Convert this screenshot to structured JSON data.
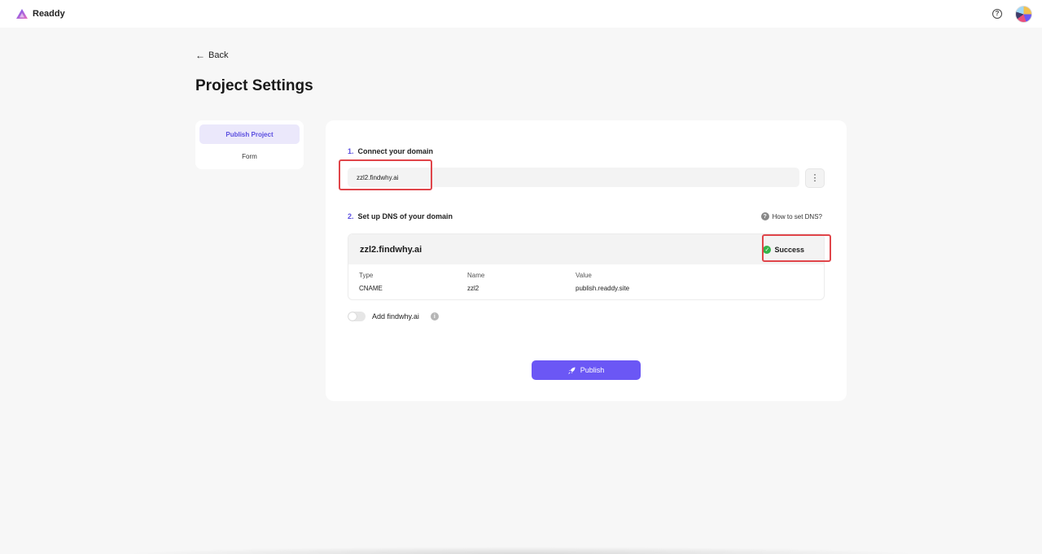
{
  "app": {
    "name": "Readdy"
  },
  "header": {
    "help_icon": "question-circle-icon",
    "avatar_icon": "user-avatar"
  },
  "nav": {
    "back_label": "Back"
  },
  "page": {
    "title": "Project Settings"
  },
  "sidebar": {
    "items": [
      {
        "label": "Publish Project",
        "active": true
      },
      {
        "label": "Form",
        "active": false
      }
    ]
  },
  "domain": {
    "step_number": "1.",
    "step_label": "Connect your domain",
    "value": "zzl2.findwhy.ai"
  },
  "dns": {
    "step_number": "2.",
    "step_label": "Set up DNS of your domain",
    "help_link": "How to set DNS?",
    "domain": "zzl2.findwhy.ai",
    "status": "Success",
    "columns": [
      "Type",
      "Name",
      "Value"
    ],
    "records": [
      {
        "type": "CNAME",
        "name": "zzl2",
        "value": "publish.readdy.site"
      }
    ]
  },
  "apex": {
    "label": "Add findwhy.ai",
    "enabled": false
  },
  "actions": {
    "publish_label": "Publish"
  },
  "colors": {
    "accent": "#6b57f5",
    "success": "#34b34a",
    "highlight": "#e0454a"
  }
}
